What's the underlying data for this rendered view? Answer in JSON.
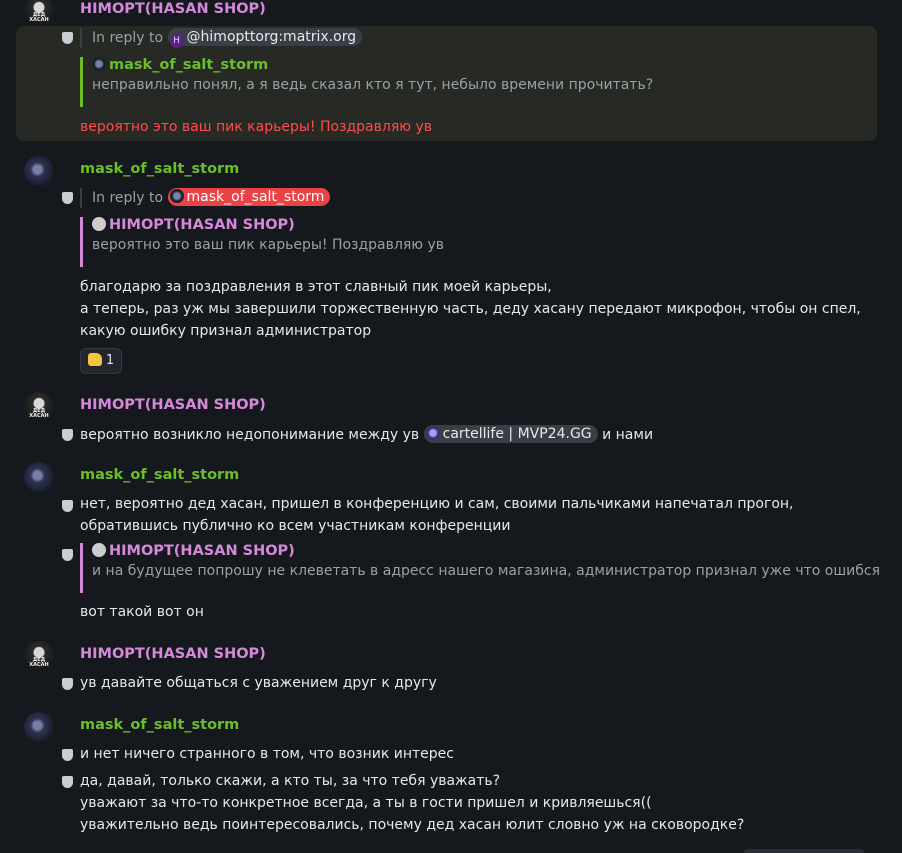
{
  "users": {
    "hasan": "НІМОРТ(HASAN SHOP)",
    "mask": "mask_of_salt_storm"
  },
  "reply_prefix": "In reply to",
  "events": {
    "e1": {
      "sender": "НІМОРТ(HASAN SHOP)",
      "reply_to": "@himopttorg:matrix.org",
      "reply_to_initial": "H",
      "quote_name": "mask_of_salt_storm",
      "quote_text": "неправильно понял, а я ведь сказал кто я тут, небыло времени прочитать?",
      "body": "вероятно это ваш пик карьеры! Поздравляю ув"
    },
    "e2": {
      "sender": "mask_of_salt_storm",
      "reply_to": "mask_of_salt_storm",
      "quote_name": "НІМОРТ(HASAN SHOP)",
      "quote_text": "вероятно это ваш пик карьеры! Поздравляю ув",
      "body_lines": [
        "благодарю за поздравления в этот славный пик моей карьеры,",
        "а теперь, раз уж мы завершили торжественную часть, деду хасану передают микрофон, чтобы он спел,",
        "какую ошибку признал администратор"
      ],
      "reaction_count": "1"
    },
    "e3": {
      "sender": "НІМОРТ(HASAN SHOP)",
      "body_before": "вероятно возникло недопонимание между ув",
      "mention": "cartellife | MVP24.GG",
      "body_after": "и нами"
    },
    "e4": {
      "sender": "mask_of_salt_storm",
      "body_lines": [
        "нет, вероятно дед хасан, пришел в конференцию и сам, своими пальчиками напечатал прогон,",
        "обратившись публично ко всем участникам конференции"
      ],
      "quote_name": "НІМОРТ(HASAN SHOP)",
      "quote_text": "и на будущее попрошу не клеветать в адресс нашего магазина, администратор признал уже что ошибся",
      "after_quote": "вот такой вот он"
    },
    "e5": {
      "sender": "НІМОРТ(HASAN SHOP)",
      "body": "ув давайте общаться с уважением друг к другу"
    },
    "e6": {
      "sender": "mask_of_salt_storm",
      "line1": "и нет ничего странного в том, что возник интерес",
      "body_lines": [
        "да, давай, только скажи, а кто ты, за что тебя уважать?",
        "уважают за что-то конкретное всегда, а ты в гости пришел и кривляешься((",
        "уважительно ведь поинтересовались, почему дед хасан юлит словно уж на сковородке?"
      ]
    }
  },
  "colors": {
    "hasan": "#d589d9",
    "mask": "#6bbd2a",
    "highlight_text": "#ff4b4b"
  }
}
